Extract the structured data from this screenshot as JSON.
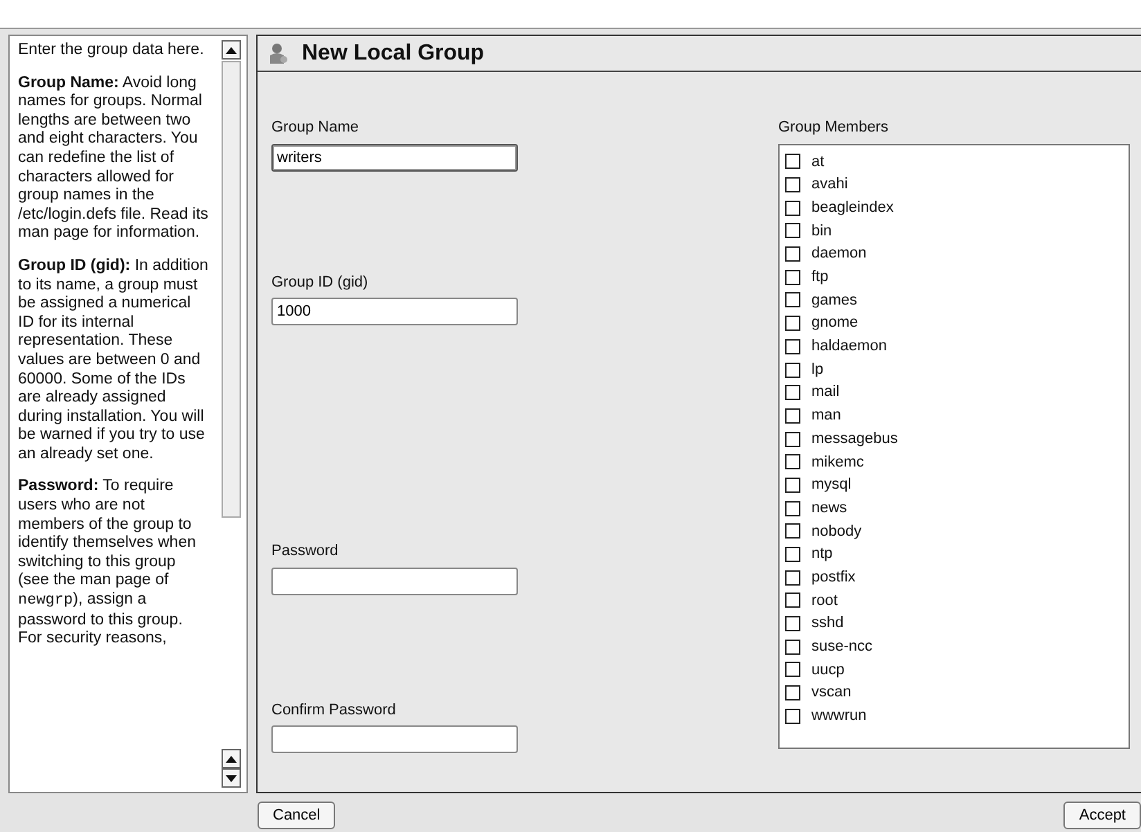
{
  "help": {
    "paragraphs": [
      [
        {
          "kind": "plain",
          "text": "Enter the group data here."
        }
      ],
      [
        {
          "kind": "bold",
          "text": "Group Name:"
        },
        {
          "kind": "plain",
          "text": " Avoid long names for groups. Normal lengths are between two and eight characters. You can redefine the list of characters allowed for group names in the /etc/login.defs file. Read its man page for information."
        }
      ],
      [
        {
          "kind": "bold",
          "text": "Group ID (gid):"
        },
        {
          "kind": "plain",
          "text": " In addition to its name, a group must be assigned a numerical ID for its internal representation. These values are between 0 and 60000. Some of the IDs are already assigned during installation. You will be warned if you try to use an already set one."
        }
      ],
      [
        {
          "kind": "bold",
          "text": "Password:"
        },
        {
          "kind": "plain",
          "text": " To require users who are not members of the group to identify themselves when switching to this group (see the man page of "
        },
        {
          "kind": "code",
          "text": "newgrp"
        },
        {
          "kind": "plain",
          "text": "), assign a password to this group. For security reasons,"
        }
      ]
    ]
  },
  "title": "New Local Group",
  "fields": [
    {
      "label": "Group Name",
      "value": "writers",
      "focused": true
    },
    {
      "label": "Group ID (gid)",
      "value": "1000",
      "focused": false
    },
    {
      "label": "Password",
      "focused": false
    },
    {
      "label": "Confirm Password",
      "focused": false
    }
  ],
  "members": {
    "label": "Group Members",
    "items": [
      {
        "name": "at",
        "checked": false
      },
      {
        "name": "avahi",
        "checked": false
      },
      {
        "name": "beagleindex",
        "checked": false
      },
      {
        "name": "bin",
        "checked": false
      },
      {
        "name": "daemon",
        "checked": false
      },
      {
        "name": "ftp",
        "checked": false
      },
      {
        "name": "games",
        "checked": false
      },
      {
        "name": "gnome",
        "checked": false
      },
      {
        "name": "haldaemon",
        "checked": false
      },
      {
        "name": "lp",
        "checked": false
      },
      {
        "name": "mail",
        "checked": false
      },
      {
        "name": "man",
        "checked": false
      },
      {
        "name": "messagebus",
        "checked": false
      },
      {
        "name": "mikemc",
        "checked": false
      },
      {
        "name": "mysql",
        "checked": false
      },
      {
        "name": "news",
        "checked": false
      },
      {
        "name": "nobody",
        "checked": false
      },
      {
        "name": "ntp",
        "checked": false
      },
      {
        "name": "postfix",
        "checked": false
      },
      {
        "name": "root",
        "checked": false
      },
      {
        "name": "sshd",
        "checked": false
      },
      {
        "name": "suse-ncc",
        "checked": false
      },
      {
        "name": "uucp",
        "checked": false
      },
      {
        "name": "vscan",
        "checked": false
      },
      {
        "name": "wwwrun",
        "checked": false
      }
    ]
  },
  "buttons": [
    {
      "label": "Cancel"
    },
    {
      "label": "Accept"
    }
  ]
}
